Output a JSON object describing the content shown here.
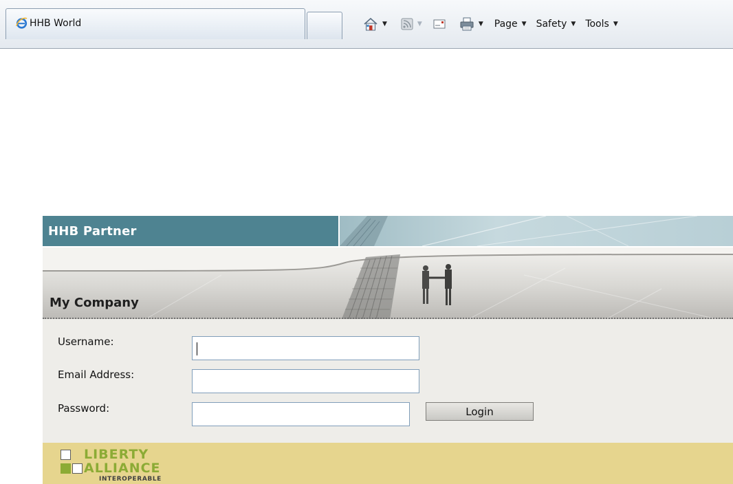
{
  "browser": {
    "tab_title": "HHB World",
    "menus": [
      {
        "label": "Page"
      },
      {
        "label": "Safety"
      },
      {
        "label": "Tools"
      }
    ],
    "icons": [
      "ie-logo-icon",
      "home-icon",
      "feeds-icon",
      "mail-icon",
      "print-icon"
    ]
  },
  "page": {
    "partner_title": "HHB Partner",
    "company_title": "My Company",
    "form": {
      "username_label": "Username:",
      "username_value": "",
      "email_label": "Email Address:",
      "email_value": "",
      "password_label": "Password:",
      "password_value": "",
      "login_label": "Login"
    },
    "footer": {
      "logo_line1": "LIBERTY",
      "logo_line2": "ALLIANCE",
      "logo_line3": "INTEROPERABLE"
    }
  },
  "colors": {
    "header_teal": "#4e8391",
    "form_background": "#eeede9",
    "footer_gold": "#e6d58e",
    "logo_green": "#8cab35"
  }
}
